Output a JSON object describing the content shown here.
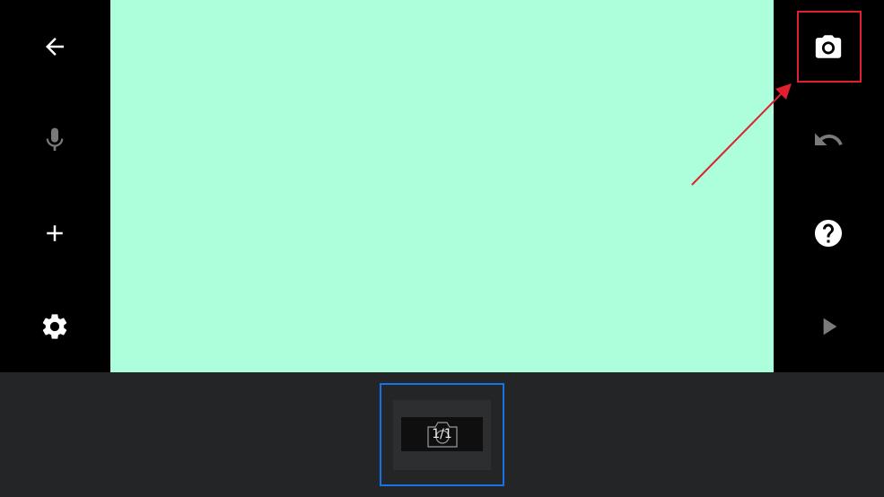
{
  "colors": {
    "canvas_background": "#adffdc",
    "toolbar_background": "#000000",
    "bottom_strip_background": "#242527",
    "icon_active": "#ffffff",
    "icon_disabled": "#7a7a7a",
    "thumbnail_selected_border": "#1672e6",
    "annotation_highlight": "#e0202f"
  },
  "left_toolbar": {
    "items": [
      {
        "icon": "back-arrow-icon",
        "enabled": true
      },
      {
        "icon": "microphone-icon",
        "enabled": false
      },
      {
        "icon": "plus-icon",
        "enabled": true
      },
      {
        "icon": "gear-icon",
        "enabled": true
      }
    ]
  },
  "right_toolbar": {
    "items": [
      {
        "icon": "camera-icon",
        "enabled": true
      },
      {
        "icon": "undo-icon",
        "enabled": false
      },
      {
        "icon": "help-icon",
        "enabled": true
      },
      {
        "icon": "play-icon",
        "enabled": false
      }
    ]
  },
  "thumbnail_strip": {
    "slides": [
      {
        "counter": "1/1",
        "icon": "camera-outline-icon",
        "selected": true
      }
    ]
  }
}
